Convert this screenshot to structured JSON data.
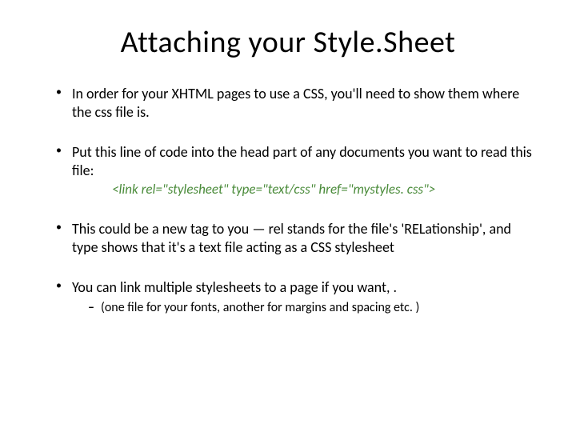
{
  "title": "Attaching your Style.Sheet",
  "bullets": {
    "b1": "In order for your XHTML pages to use a CSS, you'll need to show them where the css file is.",
    "b2": "Put this line of code into the head part of any documents you want to read this file:",
    "b2_code": "<link rel=\"stylesheet\" type=\"text/css\" href=\"mystyles. css\">",
    "b3": "This could be a new tag to you — rel stands for the file's 'RELationship', and type shows that it's a text file acting as a CSS stylesheet",
    "b4": "You can link multiple stylesheets  to a page if you want, .",
    "b4_sub": "(one file for your fonts, another for margins and spacing etc. )"
  }
}
